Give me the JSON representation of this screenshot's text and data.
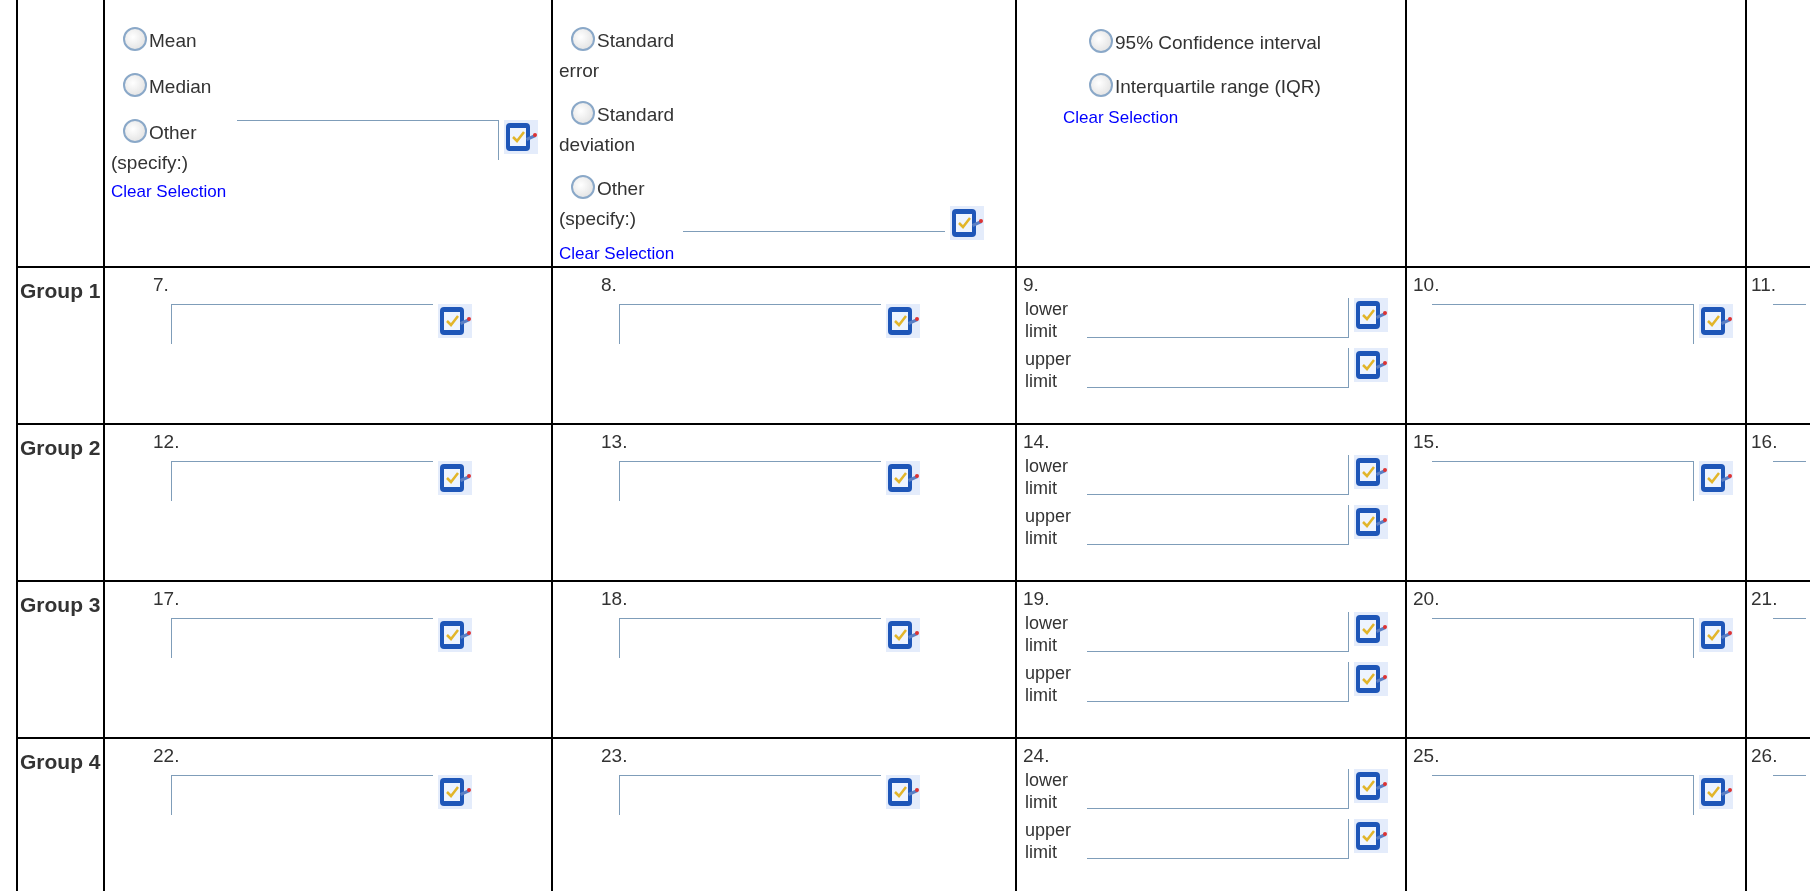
{
  "header_row": [
    {
      "options": [
        {
          "label": "Mean",
          "selected": false,
          "kind": "plain"
        },
        {
          "label": "Median",
          "selected": false,
          "kind": "plain"
        },
        {
          "label": "Other (specify:)",
          "selected": false,
          "kind": "other"
        }
      ],
      "clear_label": "Clear Selection"
    },
    {
      "options": [
        {
          "label": "Standard error",
          "selected": false,
          "kind": "plain"
        },
        {
          "label": "Standard deviation",
          "selected": false,
          "kind": "plain"
        },
        {
          "label": "Other (specify:)",
          "selected": false,
          "kind": "other"
        }
      ],
      "clear_label": "Clear Selection"
    },
    {
      "options": [
        {
          "label": "95% Confidence interval",
          "selected": false,
          "kind": "wide"
        },
        {
          "label": "Interquartile range (IQR)",
          "selected": false,
          "kind": "wide"
        }
      ],
      "clear_label": "Clear Selection"
    }
  ],
  "rows": [
    {
      "label": "Group 1",
      "cells": [
        {
          "number": "7.",
          "kind": "single"
        },
        {
          "number": "8.",
          "kind": "single"
        },
        {
          "number": "9.",
          "kind": "range",
          "limits": [
            "lower limit",
            "upper limit"
          ]
        },
        {
          "number": "10.",
          "kind": "single"
        },
        {
          "number": "11.",
          "kind": "cut"
        }
      ]
    },
    {
      "label": "Group 2",
      "cells": [
        {
          "number": "12.",
          "kind": "single"
        },
        {
          "number": "13.",
          "kind": "single"
        },
        {
          "number": "14.",
          "kind": "range",
          "limits": [
            "lower limit",
            "upper limit"
          ]
        },
        {
          "number": "15.",
          "kind": "single"
        },
        {
          "number": "16.",
          "kind": "cut"
        }
      ]
    },
    {
      "label": "Group 3",
      "cells": [
        {
          "number": "17.",
          "kind": "single"
        },
        {
          "number": "18.",
          "kind": "single"
        },
        {
          "number": "19.",
          "kind": "range",
          "limits": [
            "lower limit",
            "upper limit"
          ]
        },
        {
          "number": "20.",
          "kind": "single"
        },
        {
          "number": "21.",
          "kind": "cut"
        }
      ]
    },
    {
      "label": "Group 4",
      "cells": [
        {
          "number": "22.",
          "kind": "single"
        },
        {
          "number": "23.",
          "kind": "single"
        },
        {
          "number": "24.",
          "kind": "range",
          "limits": [
            "lower limit",
            "upper limit"
          ]
        },
        {
          "number": "25.",
          "kind": "single"
        },
        {
          "number": "26.",
          "kind": "cut"
        }
      ]
    }
  ]
}
